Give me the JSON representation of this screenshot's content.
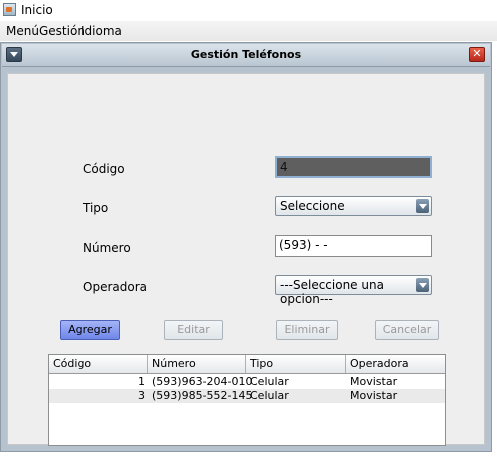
{
  "window": {
    "title": "Inicio"
  },
  "menubar": {
    "items": [
      "Menú",
      "Gestión",
      "Idioma"
    ]
  },
  "internal_frame": {
    "title": "Gestión Teléfonos",
    "close_glyph": "✕"
  },
  "form": {
    "codigo_label": "Código",
    "codigo_value": "4",
    "tipo_label": "Tipo",
    "tipo_selected": "Seleccione",
    "numero_label": "Número",
    "numero_value": "(593) -    -",
    "operadora_label": "Operadora",
    "operadora_selected": "---Seleccione una opcion---"
  },
  "buttons": {
    "agregar": "Agregar",
    "editar": "Editar",
    "eliminar": "Eliminar",
    "cancelar": "Cancelar"
  },
  "table": {
    "columns": [
      "Código",
      "Número",
      "Tipo",
      "Operadora"
    ],
    "rows": [
      {
        "codigo": "1",
        "numero": "(593)963-204-010",
        "tipo": "Celular",
        "operadora": "Movistar"
      },
      {
        "codigo": "3",
        "numero": "(593)985-552-145",
        "tipo": "Celular",
        "operadora": "Movistar"
      }
    ]
  },
  "colors": {
    "frame_bg": "#b6c2cd",
    "content_bg": "#eeeeee",
    "primary_button": "#6f86ea",
    "close_button": "#b8281a",
    "code_field_bg": "#5f5f5f"
  }
}
